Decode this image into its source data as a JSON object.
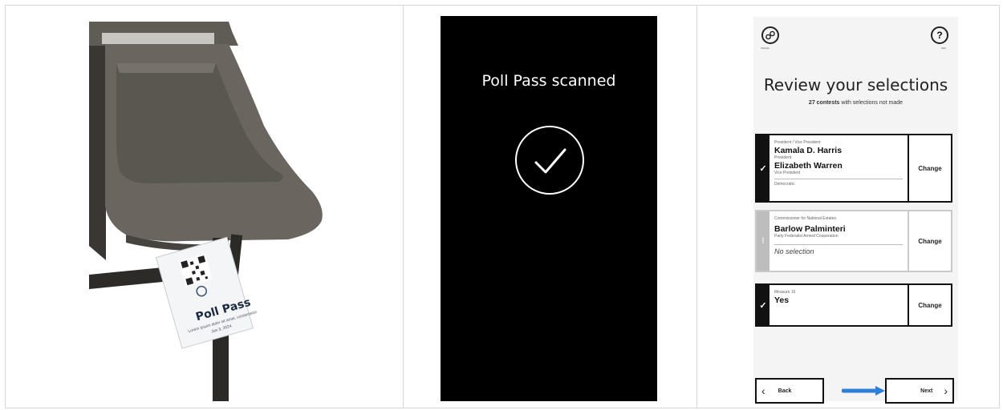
{
  "panel_photo": {
    "poll_pass": {
      "title": "Poll Pass",
      "subtitle": "Lorem ipsum dolor sit amet, consectetur",
      "date": "Jun 3, 2024"
    }
  },
  "panel_scanned": {
    "title": "Poll Pass scanned",
    "status_icon": "checkmark-circle-icon"
  },
  "panel_review": {
    "settings_label": "Settings",
    "help_label": "Help",
    "help_glyph": "?",
    "title": "Review your selections",
    "summary_count": "27 contests",
    "summary_rest": "with selections not made",
    "cards": [
      {
        "contest": "President / Vice President",
        "name1": "Kamala D. Harris",
        "role1": "President",
        "name2": "Elizabeth Warren",
        "role2": "Vice President",
        "party": "Democratic",
        "status": "✓",
        "action": "Change"
      },
      {
        "contest": "Commissioner for National Estates",
        "name1": "Barlow Palminteri",
        "role1": "Party Federalist Armed Cooperation",
        "none_text": "No selection",
        "status": "!",
        "action": "Change"
      },
      {
        "contest": "Measure 16",
        "name1": "Yes",
        "status": "✓",
        "action": "Change"
      }
    ],
    "back_label": "Back",
    "next_label": "Next",
    "colors": {
      "card_border": "#111111",
      "pointer_arrow": "#2f7fd6"
    }
  }
}
